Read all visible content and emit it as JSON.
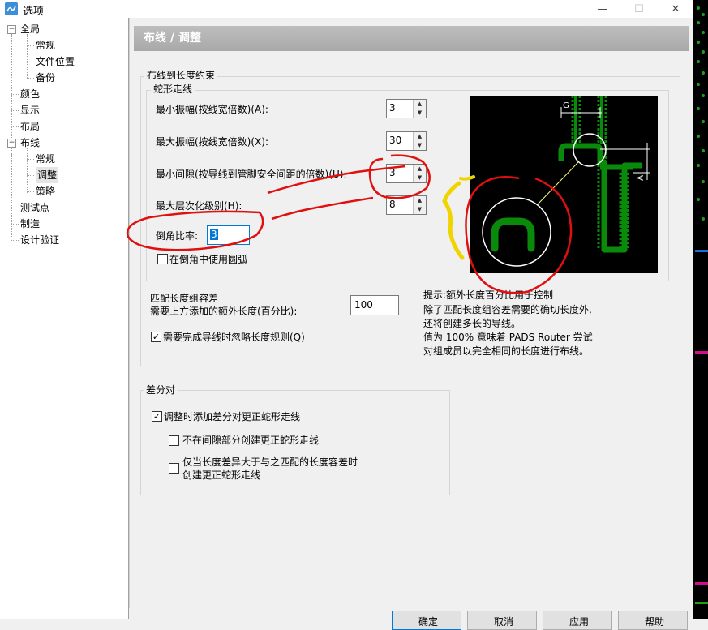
{
  "window": {
    "title": "选项",
    "minimize": "—",
    "maximize": "☐",
    "close": "✕"
  },
  "tree": [
    {
      "label": "全局",
      "level": 0,
      "expanded": true
    },
    {
      "label": "常规",
      "level": 1
    },
    {
      "label": "文件位置",
      "level": 1
    },
    {
      "label": "备份",
      "level": 1
    },
    {
      "label": "颜色",
      "level": 0
    },
    {
      "label": "显示",
      "level": 0
    },
    {
      "label": "布局",
      "level": 0
    },
    {
      "label": "布线",
      "level": 0,
      "expanded": true
    },
    {
      "label": "常规",
      "level": 1
    },
    {
      "label": "调整",
      "level": 1,
      "selected": true
    },
    {
      "label": "策略",
      "level": 1
    },
    {
      "label": "测试点",
      "level": 0
    },
    {
      "label": "制造",
      "level": 0
    },
    {
      "label": "设计验证",
      "level": 0
    }
  ],
  "page": {
    "title": "布线 / 调整"
  },
  "length_group": {
    "title": "布线到长度约束",
    "serpentine": {
      "title": "蛇形走线",
      "min_amplitude_label": "最小振幅(按线宽倍数)(A):",
      "min_amplitude_value": "3",
      "max_amplitude_label": "最大振幅(按线宽倍数)(X):",
      "max_amplitude_value": "30",
      "min_gap_label": "最小间隙(按导线到管脚安全间距的倍数)(U):",
      "min_gap_value": "3",
      "max_level_label": "最大层次化级别(H):",
      "max_level_value": "8",
      "chamfer_label": "倒角比率:",
      "chamfer_value": "3",
      "use_arcs_label": "在倒角中使用圆弧",
      "use_arcs_checked": false
    },
    "match_tolerance_label1": "匹配长度组容差",
    "match_tolerance_label2": "需要上方添加的额外长度(百分比):",
    "match_tolerance_value": "100",
    "ignore_rules_label": "需要完成导线时忽略长度规则(Q)",
    "ignore_rules_checked": true,
    "hint": [
      "提示:额外长度百分比用于控制",
      "除了匹配长度组容差需要的确切长度外,",
      "还将创建多长的导线。",
      "值为 100% 意味着 PADS Router 尝试",
      "对组成员以完全相同的长度进行布线。"
    ],
    "diagram": {
      "label_g": "G",
      "label_a": "A",
      "bg_color": "#000000",
      "trace_color": "#0a8a0a"
    }
  },
  "diff_pair_group": {
    "title": "差分对",
    "add_serpentine_label": "调整时添加差分对更正蛇形走线",
    "add_serpentine_checked": true,
    "no_gap_label": "不在间隙部分创建更正蛇形走线",
    "no_gap_checked": false,
    "only_when_label1": "仅当长度差异大于与之匹配的长度容差时",
    "only_when_label2": "创建更正蛇形走线",
    "only_when_checked": false
  },
  "buttons": {
    "ok": "确定",
    "cancel": "取消",
    "apply": "应用",
    "help": "帮助"
  },
  "annotation_colors": {
    "red": "#e01010",
    "yellow": "#f0d400"
  }
}
